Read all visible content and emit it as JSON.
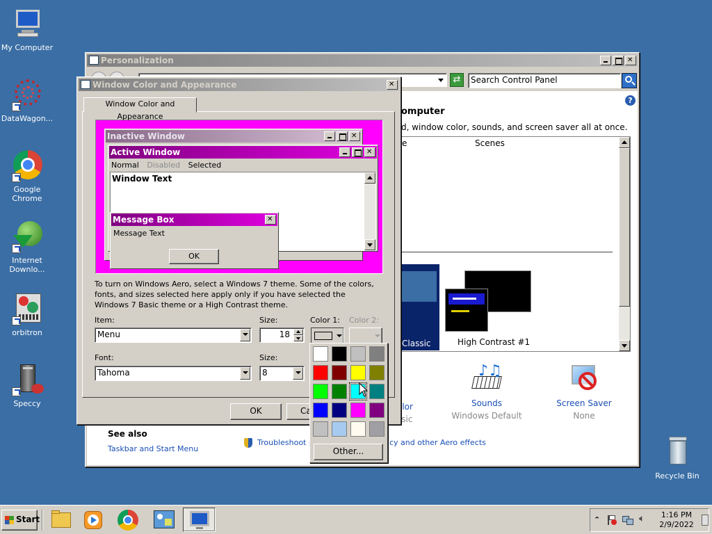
{
  "desktop": {
    "icons": [
      {
        "label": "My Computer"
      },
      {
        "label": "DataWagon..."
      },
      {
        "label": "Google Chrome"
      },
      {
        "label": "Internet\nDownlo..."
      },
      {
        "label": "orbitron"
      },
      {
        "label": "Speccy"
      },
      {
        "label": "Recycle Bin"
      }
    ]
  },
  "personalization": {
    "title": "Personalization",
    "search_placeholder": "Search Control Panel",
    "heading_partial": "omputer",
    "description_partial": "d, window color, sounds, and screen saver all at once.",
    "column_partial": "e",
    "column_scenes": "Scenes",
    "theme_classic_partial": "Classic",
    "theme_hc1": "High Contrast #1",
    "items": {
      "color_partial": "olor",
      "color_sub_partial": "ssic",
      "sounds": "Sounds",
      "sounds_sub": "Windows Default",
      "screensaver": "Screen Saver",
      "screensaver_sub": "None"
    },
    "see_also": "See also",
    "taskbar_link": "Taskbar and Start Menu",
    "troubleshoot_partial": "Troubleshoot pr",
    "aero_partial": "cy and other Aero effects"
  },
  "dialog": {
    "title": "Window Color and Appearance",
    "tab": "Window Color and Appearance",
    "preview": {
      "inactive_title": "Inactive Window",
      "active_title": "Active Window",
      "menu_normal": "Normal",
      "menu_disabled": "Disabled",
      "menu_selected": "Selected",
      "window_text": "Window Text",
      "msgbox_title": "Message Box",
      "msgbox_text": "Message Text",
      "msgbox_ok": "OK"
    },
    "info": "To turn on Windows Aero, select a Windows 7 theme.  Some of the colors, fonts, and sizes selected here apply only if you have selected the Windows 7 Basic theme or a High Contrast theme.",
    "item_label": "Item:",
    "item_value": "Menu",
    "size_label": "Size:",
    "size_value": "18",
    "color1_label": "Color 1:",
    "color2_label": "Color 2:",
    "font_label": "Font:",
    "font_value": "Tahoma",
    "font_size_label": "Size:",
    "font_size_value": "8",
    "ok": "OK",
    "cancel_partial": "Ca",
    "color_popup_other": "Other...",
    "colors": [
      "#ffffff",
      "#000000",
      "#c0c0c0",
      "#808080",
      "#ff0000",
      "#800000",
      "#ffff00",
      "#808000",
      "#00ff00",
      "#008000",
      "#00ffff",
      "#008080",
      "#0000ff",
      "#000080",
      "#ff00ff",
      "#800080",
      "#c0c0c0",
      "#a6caf0",
      "#fffbf0",
      "#a0a0a4"
    ]
  },
  "taskbar": {
    "start": "Start",
    "time": "1:16 PM",
    "date": "2/9/2022"
  }
}
